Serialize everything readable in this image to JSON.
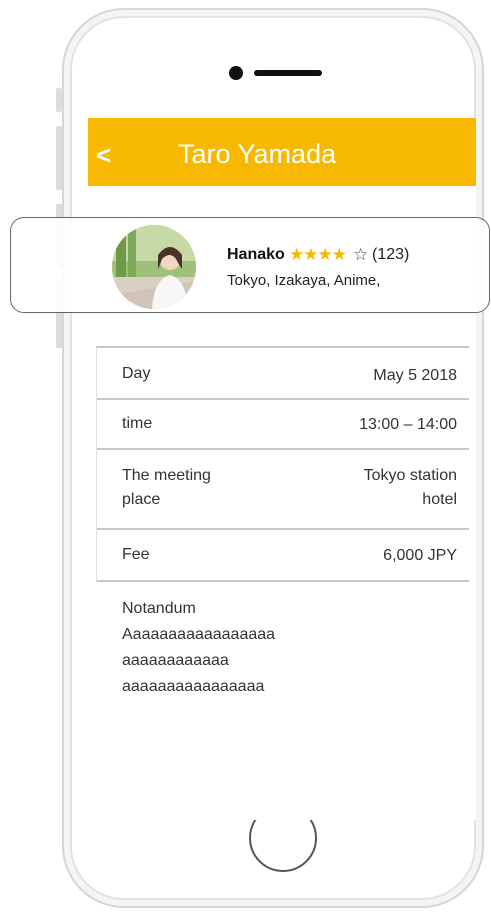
{
  "header": {
    "back_label": "<",
    "title": "Taro Yamada",
    "background_color": "#f6b800"
  },
  "profile": {
    "name": "Hanako",
    "stars_filled": "★★★★",
    "stars_empty": "☆",
    "rating_value": 4,
    "rating_max": 5,
    "review_count": "(123)",
    "tags": "Tokyo, Izakaya, Anime,"
  },
  "details": {
    "rows": [
      {
        "label": "Day",
        "value": "May 5 2018"
      },
      {
        "label": "time",
        "value": "13:00 – 14:00"
      },
      {
        "label_line1": "The meeting",
        "label_line2": "place",
        "value_line1": "Tokyo station",
        "value_line2": "hotel"
      },
      {
        "label": "Fee",
        "value": "6,000 JPY"
      }
    ]
  },
  "notes": {
    "heading": "Notandum",
    "lines": [
      "Aaaaaaaaaaaaaaaaa",
      "aaaaaaaaaaaa",
      "aaaaaaaaaaaaaaaa"
    ]
  }
}
